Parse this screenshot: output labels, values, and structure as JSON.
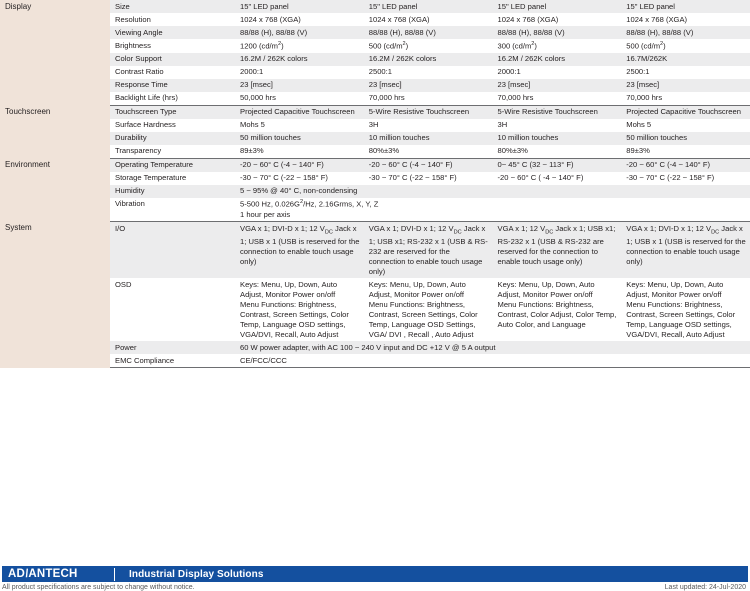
{
  "document": {
    "type": "product-specification-table",
    "columns": 4
  },
  "sections": [
    {
      "category": "Display",
      "rows": [
        {
          "label": "Size",
          "values": [
            "15\" LED panel",
            "15\" LED panel",
            "15\" LED panel",
            "15\" LED panel"
          ]
        },
        {
          "label": "Resolution",
          "values": [
            "1024 x 768 (XGA)",
            "1024 x 768 (XGA)",
            "1024 x 768 (XGA)",
            "1024 x 768 (XGA)"
          ]
        },
        {
          "label": "Viewing Angle",
          "values": [
            "88/88 (H), 88/88 (V)",
            "88/88 (H), 88/88 (V)",
            "88/88 (H), 88/88 (V)",
            "88/88 (H), 88/88 (V)"
          ]
        },
        {
          "label": "Brightness",
          "values": [
            "1200 (cd/m2)",
            "500 (cd/m2)",
            "300 (cd/m2)",
            "500 (cd/m2)"
          ]
        },
        {
          "label": "Color Support",
          "values": [
            "16.2M / 262K colors",
            "16.2M / 262K colors",
            "16.2M / 262K colors",
            "16.7M/262K"
          ]
        },
        {
          "label": "Contrast Ratio",
          "values": [
            "2000:1",
            "2500:1",
            "2000:1",
            "2500:1"
          ]
        },
        {
          "label": "Response Time",
          "values": [
            "23 [msec]",
            "23 [msec]",
            "23 [msec]",
            "23 [msec]"
          ]
        },
        {
          "label": "Backlight Life (hrs)",
          "values": [
            "50,000 hrs",
            "70,000 hrs",
            "70,000 hrs",
            "70,000 hrs"
          ]
        }
      ]
    },
    {
      "category": "Touchscreen",
      "rows": [
        {
          "label": "Touchscreen Type",
          "values": [
            "Projected Capacitive Touchscreen",
            "5-Wire Resistive Touchscreen",
            "5-Wire Resistive Touchscreen",
            "Projected Capacitive Touchscreen"
          ]
        },
        {
          "label": "Surface Hardness",
          "values": [
            "Mohs 5",
            "3H",
            "3H",
            "Mohs 5"
          ]
        },
        {
          "label": "Durability",
          "values": [
            "50 million touches",
            "10 million  touches",
            "10 million touches",
            "50 million touches"
          ]
        },
        {
          "label": "Transparency",
          "values": [
            "89±3%",
            "80%±3%",
            "80%±3%",
            "89±3%"
          ]
        }
      ]
    },
    {
      "category": "Environment",
      "rows": [
        {
          "label": "Operating Temperature",
          "values": [
            "-20 ~ 60° C (-4 ~ 140° F)",
            "-20 ~ 60° C (-4 ~ 140° F)",
            "0~ 45° C (32 ~ 113° F)",
            "-20 ~ 60° C (-4 ~ 140° F)"
          ]
        },
        {
          "label": "Storage Temperature",
          "values": [
            "-30 ~ 70° C (-22 ~ 158° F)",
            "-30 ~ 70° C (-22 ~ 158° F)",
            "-20 ~ 60° C ( -4 ~ 140° F)",
            "-30 ~ 70° C (-22 ~ 158° F)"
          ]
        },
        {
          "label": "Humidity",
          "span": true,
          "values": [
            "5 ~ 95% @ 40° C, non-condensing"
          ]
        },
        {
          "label": "Vibration",
          "span": true,
          "values": [
            "5-500 Hz, 0.026G2/Hz, 2.16Grms, X, Y, Z\n1 hour per axis"
          ]
        }
      ]
    },
    {
      "category": "System",
      "rows": [
        {
          "label": "I/O",
          "values": [
            "VGA x 1; DVI-D x 1; 12 VDC Jack x 1; USB x 1 (USB is reserved for the connection to enable touch usage only)",
            "VGA x 1; DVI-D x 1; 12 VDC Jack x 1; USB x1; RS-232 x 1 (USB & RS-232 are reserved for the connection to enable touch usage only)",
            "VGA x 1; 12 VDC Jack x 1; USB x1; RS-232 x 1 (USB & RS-232 are reserved for the connection to enable touch usage only)",
            "VGA x 1; DVI-D x 1; 12 VDC Jack x 1; USB x 1 (USB is reserved for the connection to enable touch usage only)"
          ]
        },
        {
          "label": "OSD",
          "values": [
            "Keys: Menu, Up, Down, Auto Adjust, Monitor Power on/off\nMenu Functions: Brightness, Contrast, Screen Settings, Color Temp, Language OSD settings, VGA/DVI, Recall, Auto Adjust",
            "Keys: Menu, Up, Down, Auto Adjust, Monitor Power on/off\nMenu Functions: Brightness, Contrast, Screen Settings, Color Temp, Language  OSD Settings,\nVGA/ DVI , Recall , Auto Adjust",
            "Keys: Menu, Up, Down, Auto Adjust, Monitor Power on/off\nMenu Functions: Brightness, Contrast, Color Adjust, Color Temp, Auto Color, and Language",
            "Keys: Menu, Up, Down, Auto Adjust, Monitor Power on/off\nMenu Functions: Brightness, Contrast, Screen Settings, Color Temp, Language OSD settings, VGA/DVI, Recall, Auto Adjust"
          ]
        },
        {
          "label": "Power",
          "span": true,
          "values": [
            "60 W power adapter, with AC 100 ~ 240 V input and DC +12 V @ 5 A output"
          ]
        },
        {
          "label": "EMC Compliance",
          "span": true,
          "values": [
            "CE/FCC/CCC"
          ]
        }
      ]
    }
  ],
  "footer": {
    "brand": "ADVANTECH",
    "brand_part1": "AD",
    "brand_slash": "\\",
    "brand_part2": "ANTECH",
    "tagline": "Industrial Display Solutions",
    "disclaimer": "All product specifications are subject to change without notice.",
    "last_updated": "Last updated: 24-Jul-2020",
    "bar_color": "#14509f"
  }
}
